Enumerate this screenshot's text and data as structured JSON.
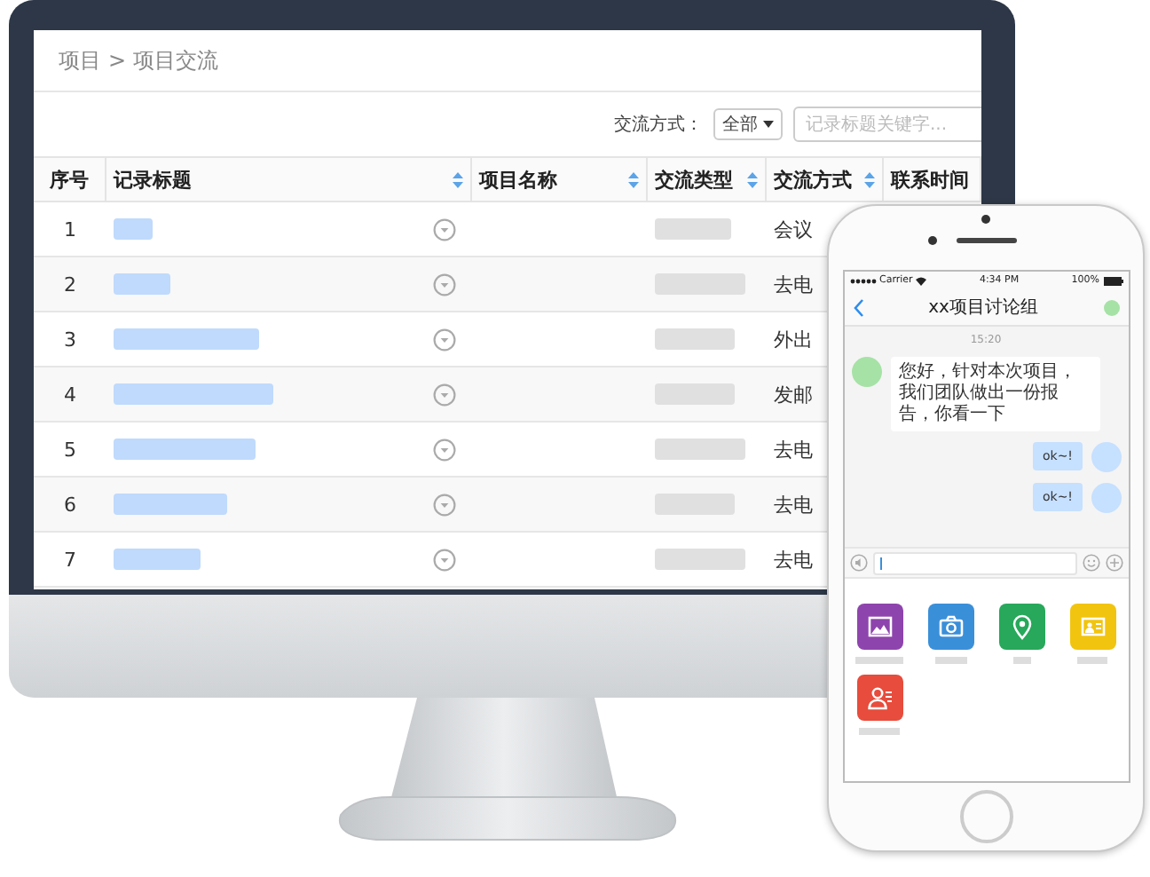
{
  "desktop": {
    "breadcrumb": {
      "items": [
        "项目",
        "项目交流"
      ],
      "separator": ">"
    },
    "filter": {
      "label": "交流方式：",
      "dropdown": {
        "value": "全部"
      },
      "search": {
        "placeholder": "记录标题关键字..."
      }
    },
    "table": {
      "columns": [
        {
          "label": "序号",
          "sortable": false
        },
        {
          "label": "记录标题",
          "sortable": true
        },
        {
          "label": "项目名称",
          "sortable": true
        },
        {
          "label": "交流类型",
          "sortable": true
        },
        {
          "label": "交流方式",
          "sortable": true
        },
        {
          "label": "联系时间",
          "sortable": false
        }
      ],
      "rows": [
        {
          "index": "1",
          "method": "会议"
        },
        {
          "index": "2",
          "method": "去电"
        },
        {
          "index": "3",
          "method": "外出"
        },
        {
          "index": "4",
          "method": "发邮"
        },
        {
          "index": "5",
          "method": "去电"
        },
        {
          "index": "6",
          "method": "去电"
        },
        {
          "index": "7",
          "method": "去电"
        }
      ]
    }
  },
  "phone": {
    "status_bar": {
      "carrier": "Carrier",
      "time": "4:34 PM",
      "battery": "100%"
    },
    "chat": {
      "title": "xx项目讨论组",
      "timestamp": "15:20",
      "messages": [
        {
          "kind": "incoming",
          "text": "您好，针对本次项目，我们团队做出一份报告，你看一下"
        },
        {
          "kind": "outgoing",
          "text": "ok~!"
        },
        {
          "kind": "outgoing",
          "text": "ok~!"
        }
      ]
    },
    "attachments": [
      {
        "kind": "gallery",
        "color": "#8e44ad"
      },
      {
        "kind": "camera",
        "color": "#3a8fd9"
      },
      {
        "kind": "location",
        "color": "#27a85a"
      },
      {
        "kind": "card",
        "color": "#f1c40f"
      },
      {
        "kind": "contact",
        "color": "#e74c3c"
      }
    ]
  }
}
